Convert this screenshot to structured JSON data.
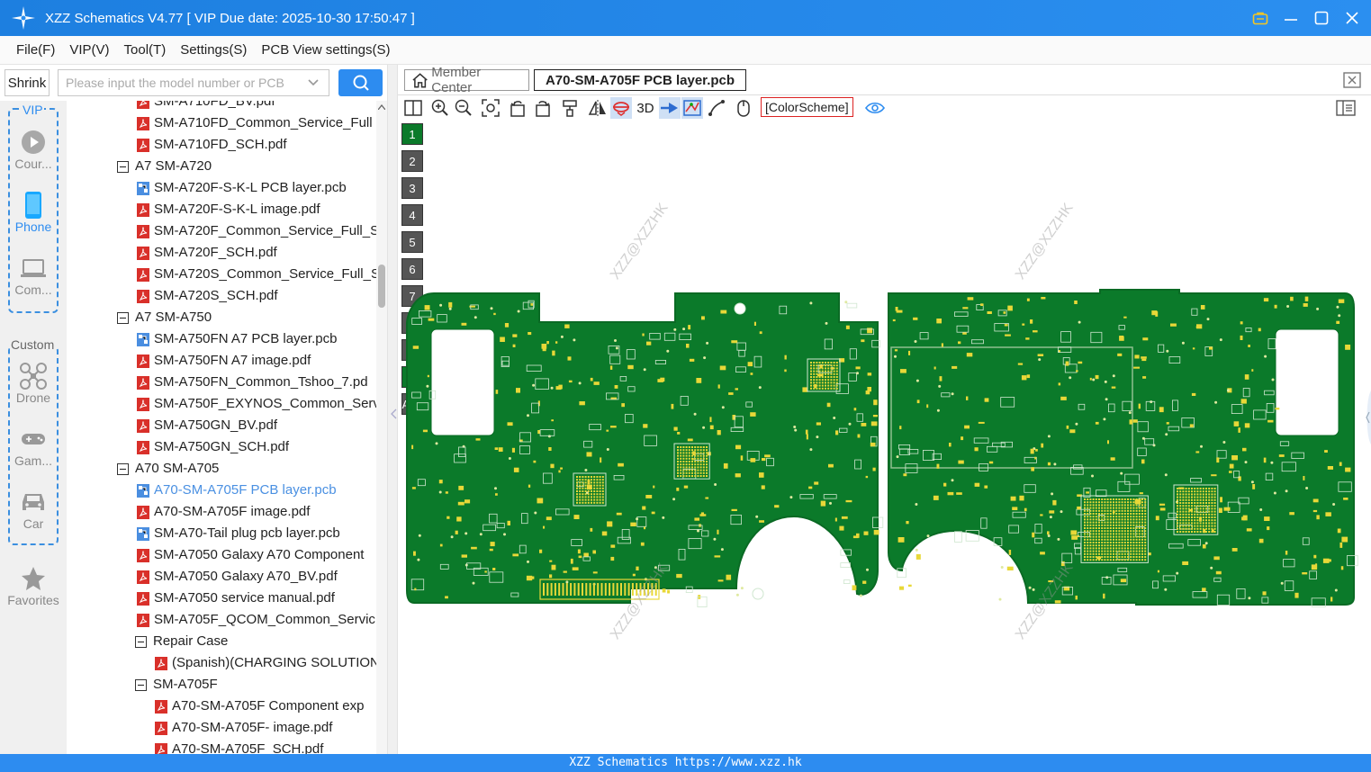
{
  "window": {
    "title": "XZZ Schematics V4.77 [ VIP Due date: 2025-10-30 17:50:47 ]",
    "icons": [
      "vip-badge-icon",
      "minimize-icon",
      "maximize-icon",
      "close-icon"
    ]
  },
  "menu": {
    "file": "File(F)",
    "vip": "VIP(V)",
    "tool": "Tool(T)",
    "settings": "Settings(S)",
    "pcb_view": "PCB View settings(S)"
  },
  "sidebar": {
    "shrink_label": "Shrink",
    "search_placeholder": "Please input the model number or PCB",
    "vip_group_label": "VIP",
    "custom_group_label": "Custom",
    "items": [
      {
        "label": "Cour...",
        "icon": "play-icon"
      },
      {
        "label": "Phone",
        "icon": "phone-icon"
      },
      {
        "label": "Com...",
        "icon": "laptop-icon"
      },
      {
        "label": "Drone",
        "icon": "drone-icon"
      },
      {
        "label": "Gam...",
        "icon": "gamepad-icon"
      },
      {
        "label": "Car",
        "icon": "car-icon"
      },
      {
        "label": "Favorites",
        "icon": "star-icon"
      }
    ]
  },
  "tree": {
    "rows": [
      {
        "label": "SM-A710FD_BV.pdf",
        "type": "pdf",
        "level": 2
      },
      {
        "label": "SM-A710FD_Common_Service_Full",
        "type": "pdf",
        "level": 2
      },
      {
        "label": "SM-A710FD_SCH.pdf",
        "type": "pdf",
        "level": 2
      },
      {
        "label": "A7 SM-A720",
        "type": "folder",
        "level": 1
      },
      {
        "label": "SM-A720F-S-K-L PCB layer.pcb",
        "type": "pcb",
        "level": 2
      },
      {
        "label": "SM-A720F-S-K-L image.pdf",
        "type": "pdf",
        "level": 2
      },
      {
        "label": "SM-A720F_Common_Service_Full_S",
        "type": "pdf",
        "level": 2
      },
      {
        "label": "SM-A720F_SCH.pdf",
        "type": "pdf",
        "level": 2
      },
      {
        "label": "SM-A720S_Common_Service_Full_S",
        "type": "pdf",
        "level": 2
      },
      {
        "label": "SM-A720S_SCH.pdf",
        "type": "pdf",
        "level": 2
      },
      {
        "label": "A7 SM-A750",
        "type": "folder",
        "level": 1
      },
      {
        "label": "SM-A750FN A7 PCB layer.pcb",
        "type": "pcb",
        "level": 2
      },
      {
        "label": "SM-A750FN A7 image.pdf",
        "type": "pdf",
        "level": 2
      },
      {
        "label": "SM-A750FN_Common_Tshoo_7.pd",
        "type": "pdf",
        "level": 2
      },
      {
        "label": "SM-A750F_EXYNOS_Common_Serv",
        "type": "pdf",
        "level": 2
      },
      {
        "label": "SM-A750GN_BV.pdf",
        "type": "pdf",
        "level": 2
      },
      {
        "label": "SM-A750GN_SCH.pdf",
        "type": "pdf",
        "level": 2
      },
      {
        "label": "A70 SM-A705",
        "type": "folder",
        "level": 1
      },
      {
        "label": "A70-SM-A705F PCB layer.pcb",
        "type": "pcb",
        "level": 2,
        "selected": true
      },
      {
        "label": "A70-SM-A705F image.pdf",
        "type": "pdf",
        "level": 2
      },
      {
        "label": "SM-A70-Tail plug pcb layer.pcb",
        "type": "pcb",
        "level": 2
      },
      {
        "label": "SM-A7050 Galaxy A70 Component",
        "type": "pdf",
        "level": 2
      },
      {
        "label": "SM-A7050 Galaxy A70_BV.pdf",
        "type": "pdf",
        "level": 2
      },
      {
        "label": "SM-A7050 service manual.pdf",
        "type": "pdf",
        "level": 2
      },
      {
        "label": "SM-A705F_QCOM_Common_Servic",
        "type": "pdf",
        "level": 2
      },
      {
        "label": "Repair Case",
        "type": "folder",
        "level": 2
      },
      {
        "label": "(Spanish)(CHARGING SOLUTION",
        "type": "pdf",
        "level": 3
      },
      {
        "label": "SM-A705F",
        "type": "folder",
        "level": 2
      },
      {
        "label": "A70-SM-A705F Component exp",
        "type": "pdf",
        "level": 3
      },
      {
        "label": "A70-SM-A705F- image.pdf",
        "type": "pdf",
        "level": 3
      },
      {
        "label": "A70-SM-A705F_SCH.pdf",
        "type": "pdf",
        "level": 3
      }
    ]
  },
  "tabs": {
    "member_center": "Member Center",
    "active_file": "A70-SM-A705F PCB layer.pcb"
  },
  "toolbar": {
    "label_3d": "3D",
    "color_scheme": "[ColorScheme]"
  },
  "layers": [
    "1",
    "2",
    "3",
    "4",
    "5",
    "6",
    "7",
    "8",
    "9",
    "10",
    "ALL"
  ],
  "watermark": "XZZ@XZZHK",
  "status": "XZZ Schematics https://www.xzz.hk",
  "colors": {
    "accent": "#2d8cf0",
    "pcb_green": "#0b7a2a",
    "pad_yellow": "#e8d838",
    "pdf_red": "#d9302a"
  }
}
